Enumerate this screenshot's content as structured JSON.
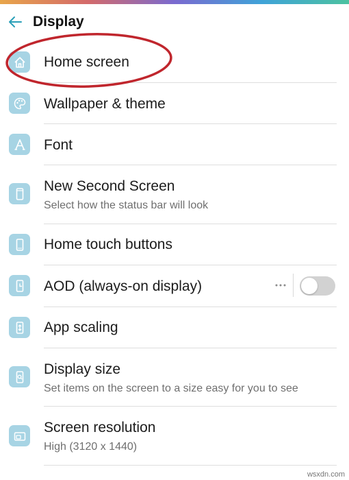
{
  "header": {
    "title": "Display",
    "back_icon": "arrow-left-icon",
    "accent": "#2a9fb8"
  },
  "colors": {
    "icon_tile": "#a7d4e4",
    "icon_glyph": "#ffffff",
    "divider": "#dedede",
    "annotation": "#c0262d",
    "toggle_off": "#d2d2d2"
  },
  "items": [
    {
      "label": "Home screen",
      "icon": "home-icon"
    },
    {
      "label": "Wallpaper & theme",
      "icon": "palette-icon"
    },
    {
      "label": "Font",
      "icon": "font-icon"
    },
    {
      "label": "New Second Screen",
      "subtitle": "Select how the status bar will look",
      "icon": "phone-outline-icon"
    },
    {
      "label": "Home touch buttons",
      "icon": "touch-buttons-icon"
    },
    {
      "label": "AOD (always-on display)",
      "icon": "clock-icon",
      "toggle": false,
      "more_icon": "more-dots-icon"
    },
    {
      "label": "App scaling",
      "icon": "scaling-icon"
    },
    {
      "label": "Display size",
      "subtitle": "Set items on the screen to a size easy for you to see",
      "icon": "zoom-icon"
    },
    {
      "label": "Screen resolution",
      "subtitle": "High (3120 x 1440)",
      "icon": "resolution-icon"
    }
  ],
  "annotation": {
    "shape": "ellipse",
    "color": "#c0262d",
    "target": "Home screen"
  },
  "watermark": "wsxdn.com"
}
